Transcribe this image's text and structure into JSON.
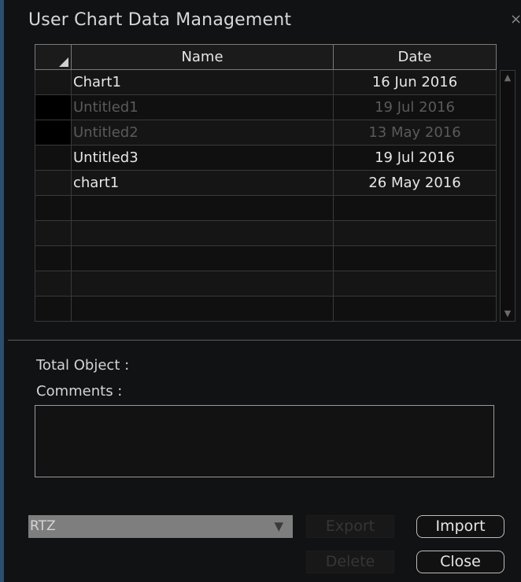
{
  "dialog": {
    "title": "User Chart Data Management",
    "close_glyph": "×"
  },
  "table": {
    "headers": {
      "name": "Name",
      "date": "Date"
    },
    "rows": [
      {
        "name": "Chart1",
        "date": "16 Jun 2016",
        "dimmed": false
      },
      {
        "name": "Untitled1",
        "date": "19 Jul 2016",
        "dimmed": true
      },
      {
        "name": "Untitled2",
        "date": "13 May 2016",
        "dimmed": true
      },
      {
        "name": "Untitled3",
        "date": "19 Jul 2016",
        "dimmed": false
      },
      {
        "name": "chart1",
        "date": "26 May 2016",
        "dimmed": false
      },
      {
        "name": "",
        "date": "",
        "dimmed": false
      },
      {
        "name": "",
        "date": "",
        "dimmed": false
      },
      {
        "name": "",
        "date": "",
        "dimmed": false
      },
      {
        "name": "",
        "date": "",
        "dimmed": false
      },
      {
        "name": "",
        "date": "",
        "dimmed": false
      }
    ]
  },
  "details": {
    "total_object_label": "Total Object :",
    "comments_label": "Comments :"
  },
  "footer": {
    "format_value": "RTZ",
    "export_label": "Export",
    "import_label": "Import",
    "delete_label": "Delete",
    "close_label": "Close"
  },
  "icons": {
    "dropdown": "chevron-down-icon",
    "scroll_up": "scroll-up-icon",
    "scroll_down": "scroll-down-icon"
  }
}
